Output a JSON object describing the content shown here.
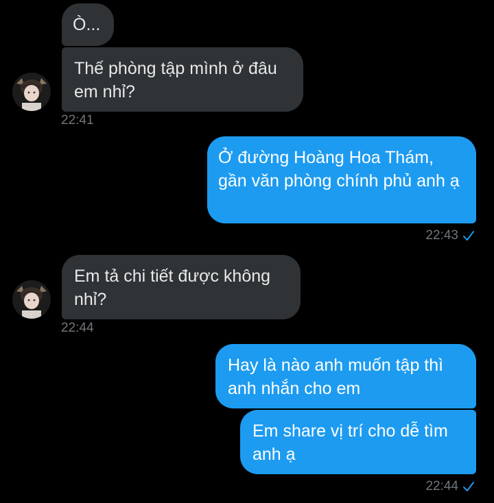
{
  "messages": [
    {
      "text": "Ò..."
    },
    {
      "text": "Thế phòng tập mình ở đâu em nhỉ?",
      "time": "22:41"
    },
    {
      "text": "Ở đường Hoàng Hoa Thám, gần văn phòng chính phủ anh ạ",
      "time": "22:43"
    },
    {
      "text": "Em tả chi tiết được không nhỉ?",
      "time": "22:44"
    },
    {
      "text": "Hay là nào anh muốn tập thì anh nhắn cho em"
    },
    {
      "text": "Em share vị trí cho dễ tìm anh ạ",
      "time": "22:44"
    }
  ],
  "colors": {
    "incoming_bubble": "#2f3336",
    "outgoing_bubble": "#1d9bf0",
    "timestamp": "#71767b",
    "read_check": "#1d9bf0"
  },
  "icons": {
    "read_receipt": "check-icon",
    "avatar": "contact-avatar"
  }
}
